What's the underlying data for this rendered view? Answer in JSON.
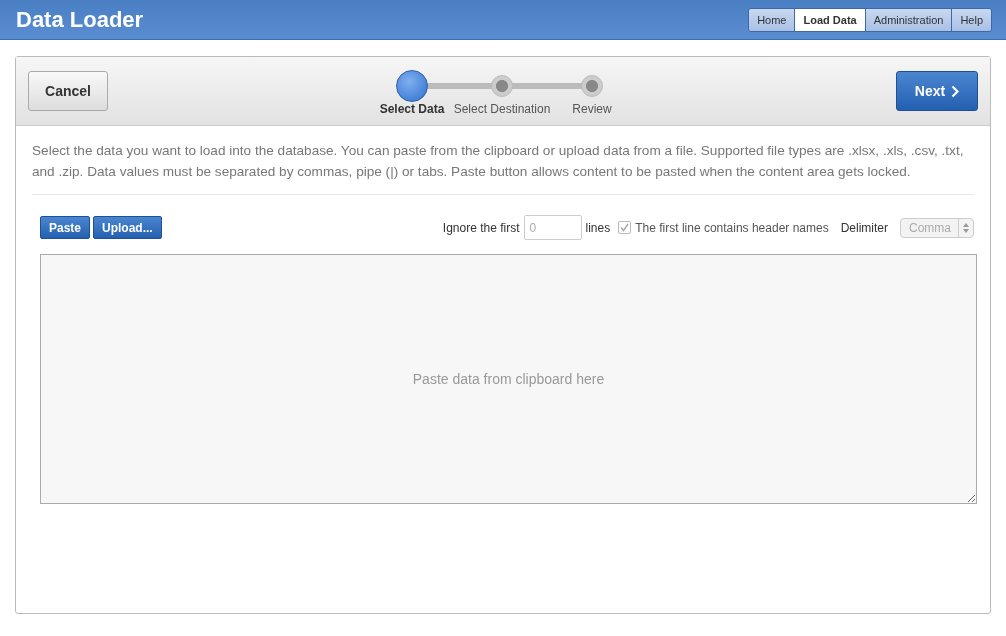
{
  "header": {
    "title": "Data Loader",
    "nav": [
      {
        "label": "Home",
        "selected": false
      },
      {
        "label": "Load Data",
        "selected": true
      },
      {
        "label": "Administration",
        "selected": false
      },
      {
        "label": "Help",
        "selected": false
      }
    ]
  },
  "wizard": {
    "cancel": "Cancel",
    "next": "Next",
    "steps": [
      {
        "label": "Select Data",
        "selected": true
      },
      {
        "label": "Select Destination",
        "selected": false
      },
      {
        "label": "Review",
        "selected": false
      }
    ]
  },
  "description": "Select the data you want to load into the database. You can paste from the clipboard or upload data from a file. Supported file types are .xlsx, .xls, .csv, .txt, and .zip. Data values must be separated by commas, pipe (|) or tabs. Paste button allows content to be pasted when the content area gets locked.",
  "toolbar": {
    "buttons": [
      "Paste",
      "Upload..."
    ],
    "ignore_label": "Ignore the first",
    "ignore_placeholder": "0",
    "lines_label": "lines",
    "header_checkbox": {
      "label": "The first line contains header names",
      "checked": true,
      "disabled": true
    },
    "delimiter_label": "Delimiter",
    "delimiter": {
      "value": "Comma",
      "disabled": true
    }
  },
  "paste_area": {
    "placeholder": "Paste data from clipboard here"
  }
}
